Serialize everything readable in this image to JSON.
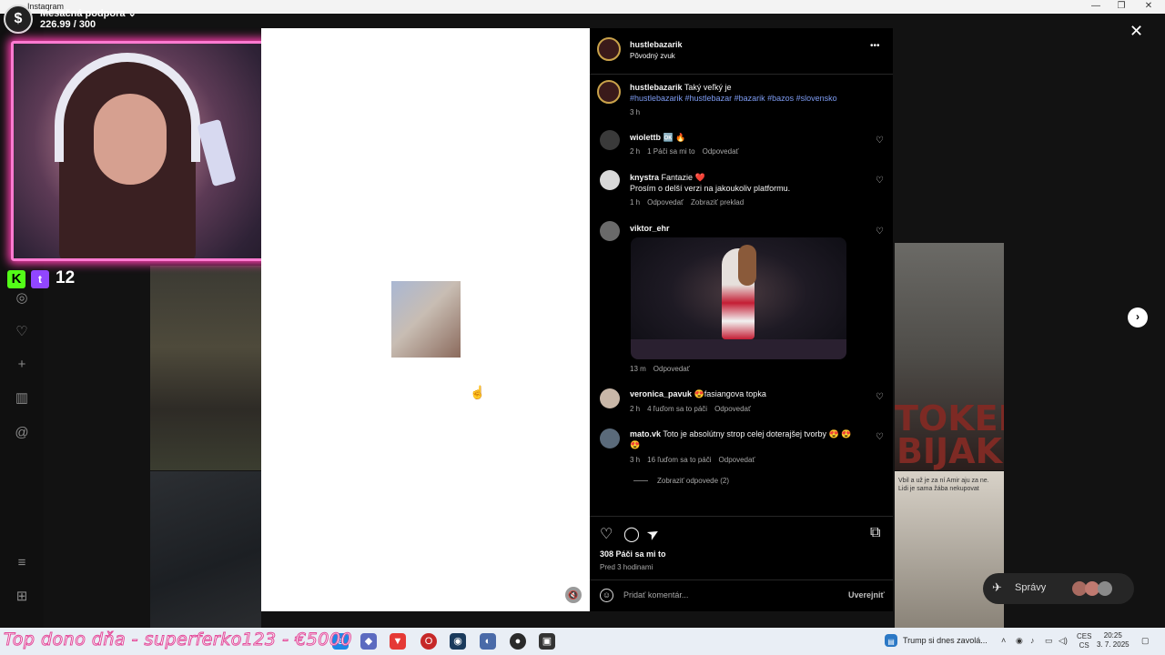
{
  "window": {
    "title": "Instagram",
    "controls": [
      "—",
      "❐",
      "✕"
    ]
  },
  "overlay": {
    "sub_goal_label": "Mesačná podpora ⌄",
    "sub_goal_value": "226.99 / 300",
    "sub_icon": "$",
    "viewer_count": "12",
    "kick_logo": "K",
    "twitch_logo": "t"
  },
  "background": {
    "tile3_text": "TOKERNÝ BIJAK",
    "tile4_text": "Vbil a už je za ní Amir aju za ne. Lidi je sama žába nekupovat",
    "dm_label": "Správy"
  },
  "post": {
    "username": "hustlebazarik",
    "audio": "Pôvodný zvuk",
    "more": "•••",
    "caption_user": "hustlebazarik",
    "caption_text": "Taký veľký je",
    "caption_tags": "#hustlebazarik #hustlebazar #bazarik #bazos #slovensko",
    "caption_time": "3 h",
    "comments": [
      {
        "user": "wiolettb",
        "text": "🆗 🔥",
        "time": "2 h",
        "likes": "1 Páči sa mi to",
        "reply": "Odpovedať"
      },
      {
        "user": "knystra",
        "text": "Fantazie ❤️",
        "text2": "Prosím o delší verzi na jakoukoliv platformu.",
        "time": "1 h",
        "reply": "Odpovedať",
        "translate": "Zobraziť preklad"
      },
      {
        "user": "viktor_ehr",
        "time": "13 m",
        "reply": "Odpovedať"
      },
      {
        "user": "veronica_pavuk",
        "text": "😍fasiangova topka",
        "time": "2 h",
        "likes": "4 ľuďom sa to páči",
        "reply": "Odpovedať"
      },
      {
        "user": "mato.vk",
        "text": "Toto je absolútny strop celej doterajšej tvorby 😍 😍",
        "text2": "😍",
        "time": "3 h",
        "likes": "16 ľuďom sa to páči",
        "reply": "Odpovedať"
      }
    ],
    "view_replies": "Zobraziť odpovede (2)",
    "likes": "308 Páči sa mi to",
    "posted": "Pred 3 hodinami",
    "comment_placeholder": "Pridať komentár...",
    "publish": "Uverejniť"
  },
  "icons": {
    "heart": "♡",
    "comment": "◯",
    "share": "➤",
    "save": "⧉",
    "close": "✕",
    "next": "›",
    "mute": "🔇",
    "emoji": "☺"
  },
  "taskbar": {
    "donor_text": "Top dono dňa - superferko123 - €5000",
    "news": "Trump si dnes zavolá...",
    "lang_top": "CES",
    "lang_bottom": "CS",
    "time": "20:25",
    "date": "3. 7. 2025"
  }
}
